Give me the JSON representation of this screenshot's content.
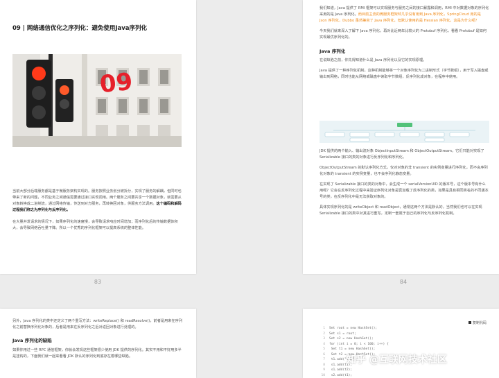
{
  "page83": {
    "title": "09 | 网络通信优化之序列化：避免使用Java序列化",
    "image_text": "09",
    "para1": "当前大部分后端服务都是基于微服务架构实现的。服务按照业务划分被拆分，实现了服务的解耦，但同时也带来了新的问题，不同业务之间通信需要通过接口实现调用。两个服务之间要共享一个数据对象，就需要从对象转换成二进制流，通过网络传输，传送到对方服务，再转换回对象，供服务方法调用。",
    "para1_bold": "这个编码和解码过程我们称之为序列化与反序列化。",
    "para2": "在大量并发请求的情况下，如果序列化的速度慢，会导致请求响应时间增加；而序列化后的传输数据体积大，会导致网络吞吐量下降。所以一个优秀的序列化框架可以提高系统的整体性能。",
    "page_number": "83"
  },
  "page84": {
    "intro_plain": "我们知道，Java 提供了 RMI 框架可以实现服务与服务之间的接口暴露和调用，RMI 中对数据对象的序列化采用的是 Java 序列化。",
    "intro_orange": "而目前主流的微服务框架却几乎没有用到 Java 序列化，SpringCloud 用的是 Json 序列化，Dubbo 虽然兼容了 Java 序列化，但默认使用的是 Hessian 序列化。这是为什么呢？",
    "para_protobuf": "今天我们就来深入了解下 Java 序列化，再对比近两年比较火的 Protobuf 序列化，看看 Protobuf 是如何实现最优序列化的。",
    "heading_java": "Java 序列化",
    "para_q": "在说缺陷之前，你先得知道什么是 Java 序列化以及它的实现原理。",
    "para_mech": "Java 提供了一种序列化机制，这种机制能够将一个对象序列化为二进制形式（字节数组），用于写入磁盘或输出到网络，同时也能从网络或磁盘中读取字节数组，反序列化成对象，在程序中使用。",
    "para_streams": "JDK 提供的两个输入、输出流对象 ObjectInputStream 和 ObjectOutputStream，它们只能对实现了 Serializable 接口的类的对象进行反序列化和序列化。",
    "para_transient": "ObjectOutputStream 的默认序列化方式，仅对对象的非 transient 的实例变量进行序列化，而不会序列化对象的 transient 的实例变量，也不会序列化静态变量。",
    "para_uid": "在实现了 Serializable 接口的类的对象中，会生成一个 serialVersionUID 的版本号，这个版本号有什么用呢？它会在反序列化过程中来验证序列化对象是否加载了反序列化的类，如果是具有相同类名的不同版本号的类，在反序列化中是无法获取对象的。",
    "para_write": "具体实现序列化的是 writeObject 和 readObject，通常这两个方法是默认的，当然我们也可以在实现 Serializable 接口的类中对其进行重写，定制一套属于自己的序列化与反序列化机制。",
    "page_number": "84"
  },
  "page85": {
    "para": "另外，Java 序列化的类中还定义了两个重写方法：writeReplace() 和 readResolve()，前者是用来在序列化之前替换序列化对象的，后者是用来在反序列化之后对返回对象进行处理的。",
    "heading": "Java 序列化的缺陷",
    "para2": "如果你用过一些 RPC 通信框架，你就会发现这些框架很少使用 JDK 提供的序列化。其实不用和不好用多半是挂钩的，下面我们就一起来看看 JDK 默认的序列化到底存在着哪些缺陷。"
  },
  "page86": {
    "code_label": "复制代码",
    "code_lines": [
      "Set root = new HashSet();",
      "Set s1 = root;",
      "Set s2 = new HashSet();",
      "for (int i = 0; i < 100; i++) {",
      "    Set t1 = new HashSet();",
      "    Set t2 = new HashSet();",
      "    t1.add(\"foo\");",
      "    s1.add(t1);",
      "    s1.add(t2);",
      "    s2.add(t1);"
    ],
    "watermark": "知乎 @互联网技术社区"
  }
}
